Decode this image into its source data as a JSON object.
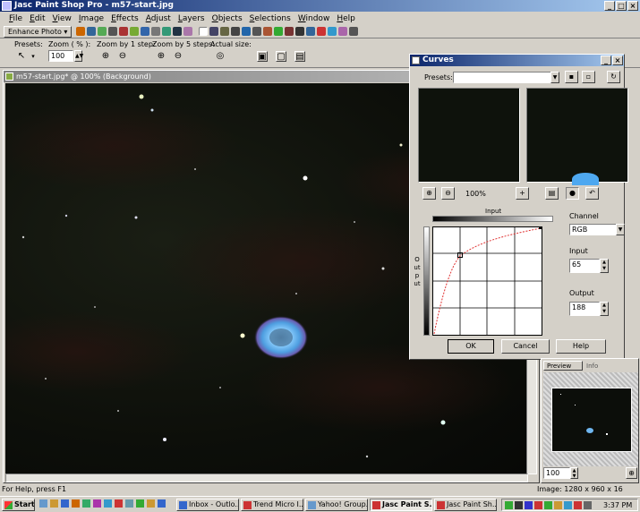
{
  "window": {
    "title": "Jasc Paint Shop Pro - m57-start.jpg"
  },
  "menu": [
    "File",
    "Edit",
    "View",
    "Image",
    "Effects",
    "Adjust",
    "Layers",
    "Objects",
    "Selections",
    "Window",
    "Help"
  ],
  "toolbar": {
    "enhance_label": "Enhance Photo"
  },
  "options": {
    "presets_label": "Presets:",
    "zoom_label": "Zoom ( % ):",
    "zoom_value": "100",
    "zoom1_label": "Zoom by 1 step:",
    "zoom5_label": "Zoom by 5 steps:",
    "actual_label": "Actual size:"
  },
  "image_window": {
    "title": "m57-start.jpg* @ 100% (Background)"
  },
  "curves": {
    "title": "Curves",
    "presets_label": "Presets:",
    "zoom_value": "100%",
    "input_label": "Input",
    "output_label": "Output",
    "channel_label": "Channel",
    "channel_value": "RGB",
    "input_field_label": "Input",
    "input_value": "65",
    "output_field_label": "Output",
    "output_value": "188",
    "ok_label": "OK",
    "cancel_label": "Cancel",
    "help_label": "Help"
  },
  "preview": {
    "tab_preview": "Preview",
    "tab_info": "Info",
    "zoom_value": "100"
  },
  "status": {
    "help_text": "For Help, press F1",
    "image_info": "Image:  1280 x 960 x 16 million"
  },
  "taskbar": {
    "start_label": "Start",
    "tasks": [
      "Inbox - Outlo...",
      "Trend Micro I...",
      "Yahoo! Group...",
      "Jasc Paint S...",
      "Jasc Paint Sh..."
    ],
    "clock": "3:37 PM"
  },
  "colors": {
    "title_active": "#0a246a",
    "title_gradient_end": "#a6caf0",
    "face": "#d4d0c8",
    "nebula": "#6fb6f0",
    "curve": "#e03030"
  }
}
